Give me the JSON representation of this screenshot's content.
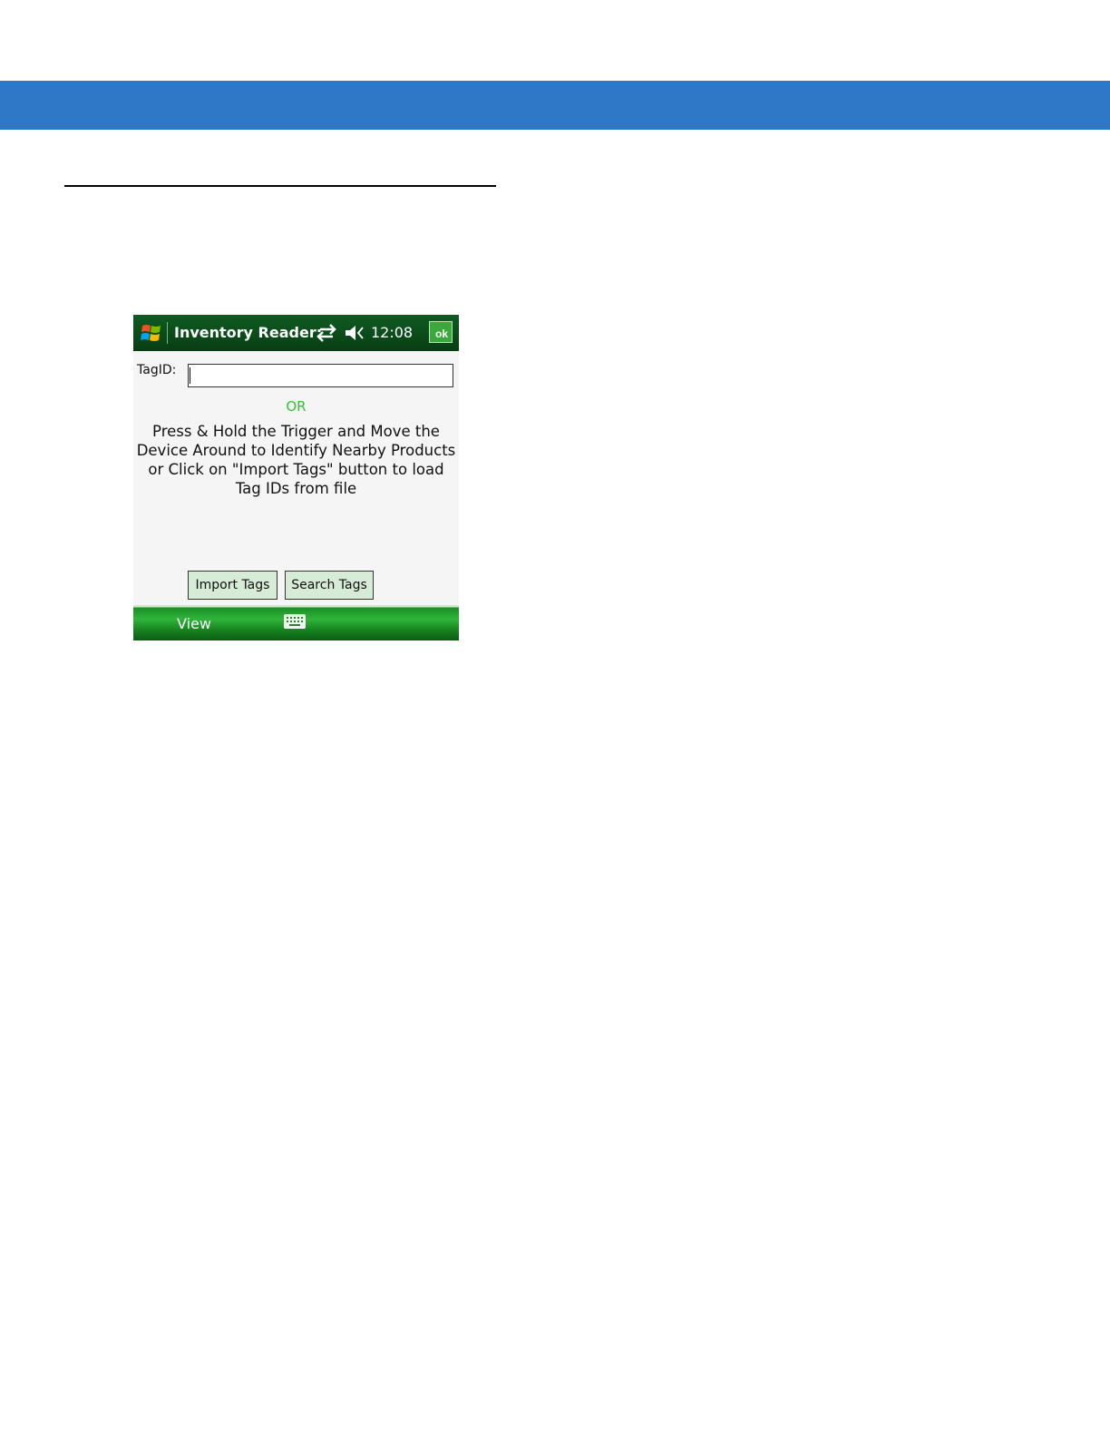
{
  "device": {
    "titlebar": {
      "app_title": "Inventory Reader:",
      "clock": "12:08",
      "ok_label": "ok"
    },
    "form": {
      "tagid_label": "TagID:",
      "tagid_value": "",
      "or_text": "OR",
      "instructions": "Press & Hold the Trigger    and Move the\nDevice Around to Identify Nearby Products\nor Click on \"Import Tags\"  button to load\nTag IDs from file"
    },
    "buttons": {
      "import_label": "Import Tags",
      "search_label": "Search Tags"
    },
    "menubar": {
      "view_label": "View"
    }
  },
  "icons": {
    "start": "windows-start-icon",
    "connectivity": "connectivity-arrows-icon",
    "volume": "volume-muted-icon",
    "keyboard": "keyboard-icon"
  },
  "colors": {
    "header_band": "#2e78c7",
    "titlebar": "#0a4a19",
    "menubar": "#2fb53b",
    "or_text": "#36c236",
    "button_fill": "#d6ecd6"
  }
}
